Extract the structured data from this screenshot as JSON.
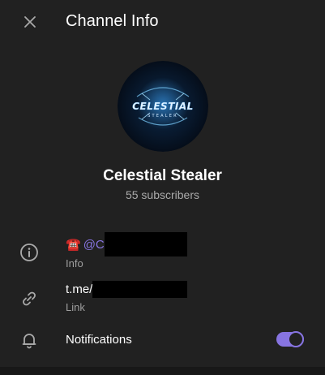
{
  "header": {
    "title": "Channel Info",
    "close_icon": "close-icon"
  },
  "channel": {
    "name": "Celestial Stealer",
    "subscribers": "55 subscribers",
    "avatar_text_main": "CELESTIAL",
    "avatar_text_sub": "STEALER"
  },
  "info_row": {
    "icon": "info-icon",
    "emoji": "☎️",
    "value_prefix": "@",
    "value_visible": "C",
    "label": "Info"
  },
  "link_row": {
    "icon": "link-icon",
    "value_prefix": "t.me/",
    "label": "Link"
  },
  "notifications_row": {
    "icon": "bell-icon",
    "label": "Notifications",
    "enabled": true
  },
  "colors": {
    "background": "#212121",
    "accent": "#8774e1",
    "secondary_text": "#aaaaaa"
  }
}
